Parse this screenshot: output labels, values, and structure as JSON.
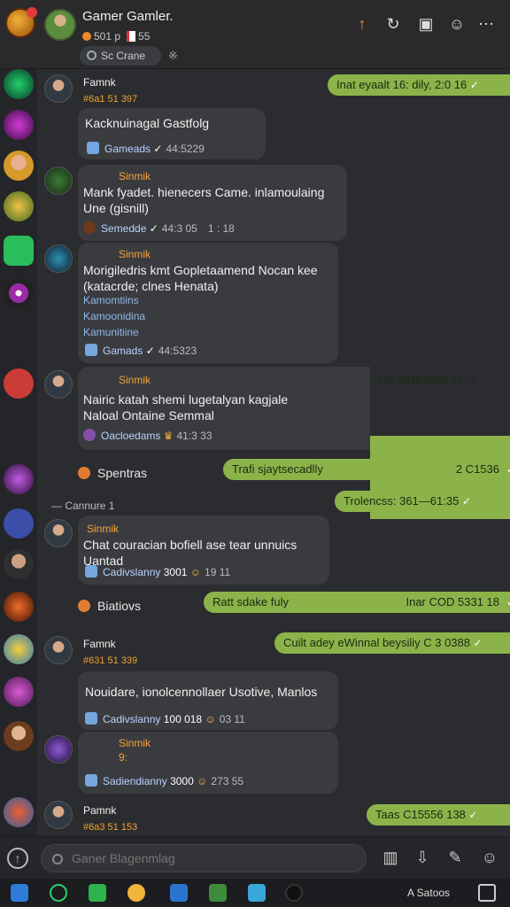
{
  "header": {
    "title": "Gamer Gamler.",
    "subtitle_count": "501 p",
    "subtitle_badge": "55",
    "pill": "Sc Crane",
    "star": "※"
  },
  "sidebar": {
    "avatars": [
      "sav1",
      "sav2",
      "sav3",
      "sav4",
      "sav5",
      "sav6",
      "sav7",
      "sav8",
      "sav9",
      "sav10",
      "sav11",
      "sav12",
      "sav13",
      "sav14",
      "sav15"
    ]
  },
  "messages": {
    "m1": {
      "name": "Famnk",
      "sub": "#6a1 51 397",
      "text": "Kacknuinagal Gastfolg",
      "meta": "Gameads",
      "time": "44:5229"
    },
    "g1": {
      "text": "Inat eyaalt 16: dily, 2:0 16"
    },
    "m2": {
      "name": "Sinmik",
      "text": "Mank fyadet. hienecers Came. inlamoulaing Une (gisnill)",
      "meta": "Semedde",
      "time": "44:3 05",
      "extra": "1 : 18"
    },
    "m3": {
      "name": "Sinmik",
      "text": "Morigiledris kmt Gopletaamend Nocan kee (katacrde; clnes Henata)",
      "lines": [
        "Kamomtiins",
        "Kamoonidina",
        "Kamunitiine"
      ],
      "meta": "Gamads",
      "time": "44:5323"
    },
    "m4": {
      "name": "Sinmik",
      "text": "Nairic katah shemi lugetalyan kagjale",
      "text2": "Naloal Ontaine Semmal",
      "meta": "Oacloedams",
      "time": "41:3 33",
      "right": "43d 2016 6833 35"
    },
    "sep1": {
      "label": "Spentras"
    },
    "g2": {
      "text": "Trafi sjaytsecadlly",
      "right": "2 C1536"
    },
    "g3": {
      "text": "Trolencss: 361—61:35"
    },
    "date1": {
      "text": "— Cannure 1"
    },
    "m5": {
      "name": "Sinmik",
      "text": "Chat couracian bofiell ase tear unnuics Uantad",
      "meta": "Cadivslanny",
      "count": "3001",
      "time": "19 11"
    },
    "sep2": {
      "label": "Biatiovs"
    },
    "g4": {
      "text": "Ratt sdake fuly",
      "right": "Inar COD 5331 18"
    },
    "g5": {
      "text": "Cuilt adey eWinnal beysiliy C 3 0388"
    },
    "m6": {
      "name": "Famnk",
      "sub": "#631 51 339",
      "text": "Nouidare, ionolcennollaer Usotive, Manlos",
      "meta": "Cadivslanny",
      "count": "100 018",
      "time": "03 11"
    },
    "m7": {
      "name": "Sinmik",
      "sub": "9:",
      "meta": "Sadiendianny",
      "count": "3000",
      "time": "273 55"
    },
    "m8": {
      "name": "Pamnk",
      "sub": "#6a3 51 153"
    },
    "g6": {
      "text": "Taas C15556 138"
    }
  },
  "input": {
    "placeholder": "Ganer Blagenmlag"
  },
  "taskbar": {
    "clock": "A Satoos"
  }
}
